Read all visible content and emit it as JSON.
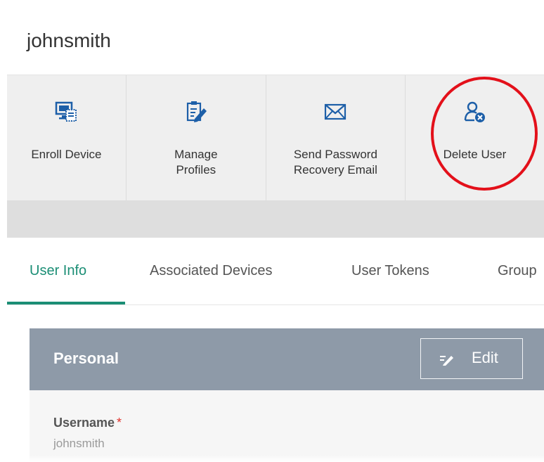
{
  "header": {
    "title": "johnsmith"
  },
  "toolbar": {
    "items": [
      {
        "label": "Enroll Device",
        "icon": "enroll-device-icon"
      },
      {
        "label": "Manage\nProfiles",
        "icon": "manage-profiles-icon"
      },
      {
        "label": "Send Password\nRecovery Email",
        "icon": "envelope-icon"
      },
      {
        "label": "Delete User",
        "icon": "delete-user-icon"
      }
    ]
  },
  "tabs": {
    "items": [
      {
        "label": "User Info",
        "active": true
      },
      {
        "label": "Associated Devices"
      },
      {
        "label": "User Tokens"
      },
      {
        "label": "Group"
      }
    ]
  },
  "card": {
    "title": "Personal",
    "edit_label": "Edit",
    "fields": [
      {
        "label": "Username",
        "required_mark": "*",
        "value": "johnsmith"
      }
    ]
  },
  "colors": {
    "accent": "#1b8e75",
    "icon_blue": "#1d5fa8",
    "card_header": "#8e9aa8",
    "annotation": "#e3101a",
    "required": "#e0322c"
  }
}
